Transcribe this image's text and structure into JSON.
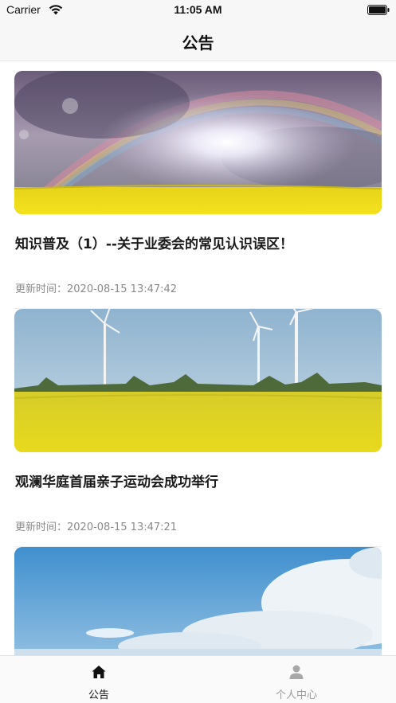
{
  "status_bar": {
    "carrier": "Carrier",
    "time": "11:05 AM"
  },
  "nav": {
    "title": "公告"
  },
  "announcements": [
    {
      "title": "知识普及（1）--关于业委会的常见认识误区！",
      "updated": "更新时间：2020-08-15 13:47:42",
      "image": "rainbow-rapeseed-field"
    },
    {
      "title": "观澜华庭首届亲子运动会成功举行",
      "updated": "更新时间：2020-08-15 13:47:21",
      "image": "wind-turbines-rapeseed-field"
    },
    {
      "title": "",
      "updated": "",
      "image": "blue-sky-clouds"
    }
  ],
  "tab_bar": {
    "tabs": [
      {
        "label": "公告",
        "icon": "home-icon",
        "active": true
      },
      {
        "label": "个人中心",
        "icon": "person-icon",
        "active": false
      }
    ]
  },
  "colors": {
    "bar_background": "#f7f7f7",
    "active_tab": "#111111",
    "inactive_tab": "#9a9a9a",
    "timestamp": "#8a8a8a"
  }
}
